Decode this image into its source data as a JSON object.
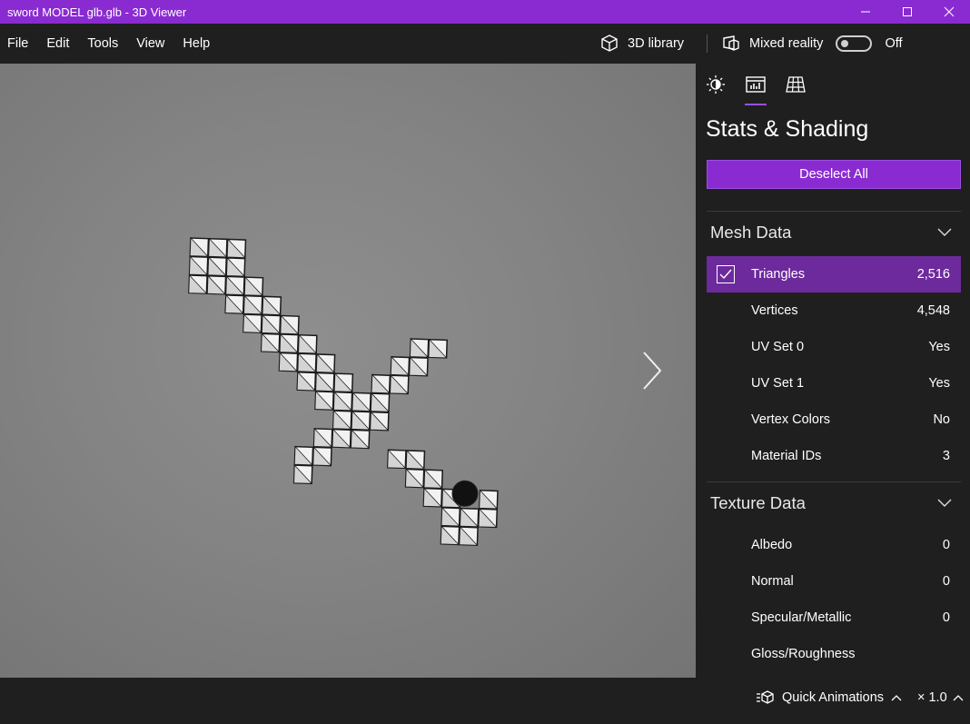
{
  "window": {
    "title": "sword MODEL glb.glb - 3D Viewer"
  },
  "menu": {
    "items": [
      "File",
      "Edit",
      "Tools",
      "View",
      "Help"
    ],
    "library_label": "3D library",
    "mixed_reality_label": "Mixed reality",
    "mixed_reality_state": "Off"
  },
  "panel": {
    "title": "Stats & Shading",
    "deselect_label": "Deselect All",
    "mesh_section": {
      "label": "Mesh Data",
      "rows": [
        {
          "name": "Triangles",
          "value": "2,516"
        },
        {
          "name": "Vertices",
          "value": "4,548"
        },
        {
          "name": "UV Set 0",
          "value": "Yes"
        },
        {
          "name": "UV Set 1",
          "value": "Yes"
        },
        {
          "name": "Vertex Colors",
          "value": "No"
        },
        {
          "name": "Material IDs",
          "value": "3"
        }
      ]
    },
    "texture_section": {
      "label": "Texture Data",
      "rows": [
        {
          "name": "Albedo",
          "value": "0"
        },
        {
          "name": "Normal",
          "value": "0"
        },
        {
          "name": "Specular/Metallic",
          "value": "0"
        },
        {
          "name": "Gloss/Roughness",
          "value": ""
        }
      ]
    }
  },
  "status": {
    "quick_animations_label": "Quick Animations",
    "speed_label": "× 1.0"
  },
  "colors": {
    "accent": "#8a2bd2",
    "selected_row": "#6d2a9c",
    "background": "#1f1f1f"
  }
}
